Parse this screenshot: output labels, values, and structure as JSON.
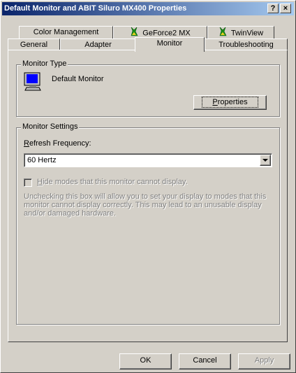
{
  "window": {
    "title": "Default Monitor and ABIT Siluro MX400 Properties",
    "help_btn": "?",
    "close_btn": "×"
  },
  "tabs": {
    "row1": [
      "Color Management",
      "GeForce2 MX",
      "TwinView"
    ],
    "row2": [
      "General",
      "Adapter",
      "Monitor",
      "Troubleshooting"
    ],
    "active": "Monitor"
  },
  "monitor_type": {
    "legend": "Monitor Type",
    "name": "Default Monitor",
    "properties_rest": "roperties",
    "properties_mnemonic": "P"
  },
  "monitor_settings": {
    "legend": "Monitor Settings",
    "refresh_mnemonic": "R",
    "refresh_label_rest": "efresh Frequency:",
    "refresh_value": "60 Hertz",
    "hide_mnemonic": "H",
    "hide_label_rest": "ide modes that this monitor cannot display.",
    "hide_checked": false,
    "description": "Unchecking this box will allow you to set your display to modes that this monitor cannot display correctly. This may lead to an unusable display and/or damaged hardware."
  },
  "footer": {
    "ok": "OK",
    "cancel": "Cancel",
    "apply": "Apply"
  }
}
